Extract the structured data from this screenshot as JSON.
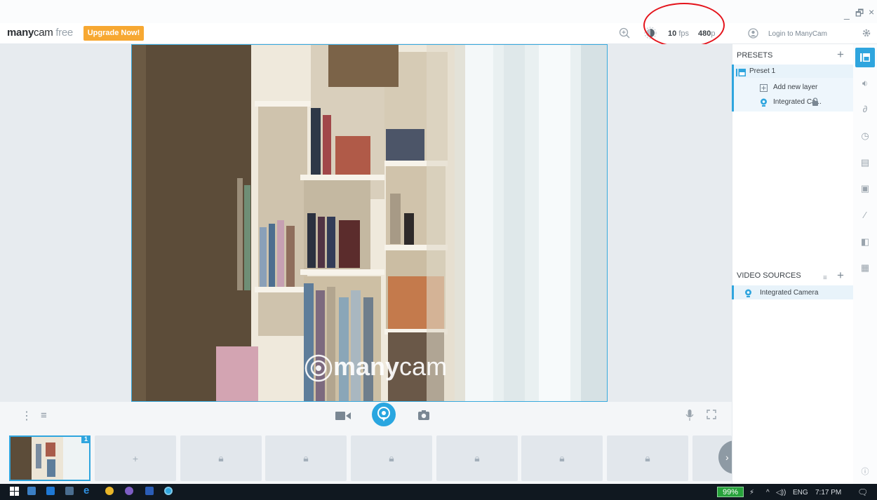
{
  "app": {
    "brand_bold": "many",
    "brand_light": "cam",
    "brand_edition": "free",
    "upgrade_label": "Upgrade Now!",
    "fps_value": "10",
    "fps_unit": "fps",
    "resolution_value": "480",
    "resolution_unit": "p",
    "login_label": "Login to ManyCam",
    "accent_color": "#2fa5de",
    "upgrade_color": "#f7a832"
  },
  "window": {
    "minimize": "_",
    "restore": "🗗",
    "close": "×"
  },
  "watermark": {
    "bold": "many",
    "light": "cam"
  },
  "presets": {
    "title": "PRESETS",
    "preset_name": "Preset 1",
    "add_layer": "Add new layer",
    "layer_name": "Integrated Ca..."
  },
  "video_sources": {
    "title": "VIDEO SOURCES",
    "source_name": "Integrated Camera"
  },
  "thumbnails": {
    "active_badge": "1",
    "add_symbol": "+",
    "locked_count": 7
  },
  "taskbar": {
    "battery": "99%",
    "language": "ENG",
    "time": "7:17 PM"
  },
  "icons": [
    "zoom-in-icon",
    "brightness-icon",
    "user-circle-icon",
    "gear-icon",
    "videocam-icon",
    "broadcast-icon",
    "camera-icon",
    "mic-icon",
    "fullscreen-icon",
    "lock-icon",
    "layers-icon",
    "audio-icon",
    "draw-icon",
    "clock-icon",
    "lower-third-icon",
    "chroma-icon",
    "magic-wand-icon",
    "overlay-icon",
    "widgets-icon",
    "info-icon"
  ]
}
